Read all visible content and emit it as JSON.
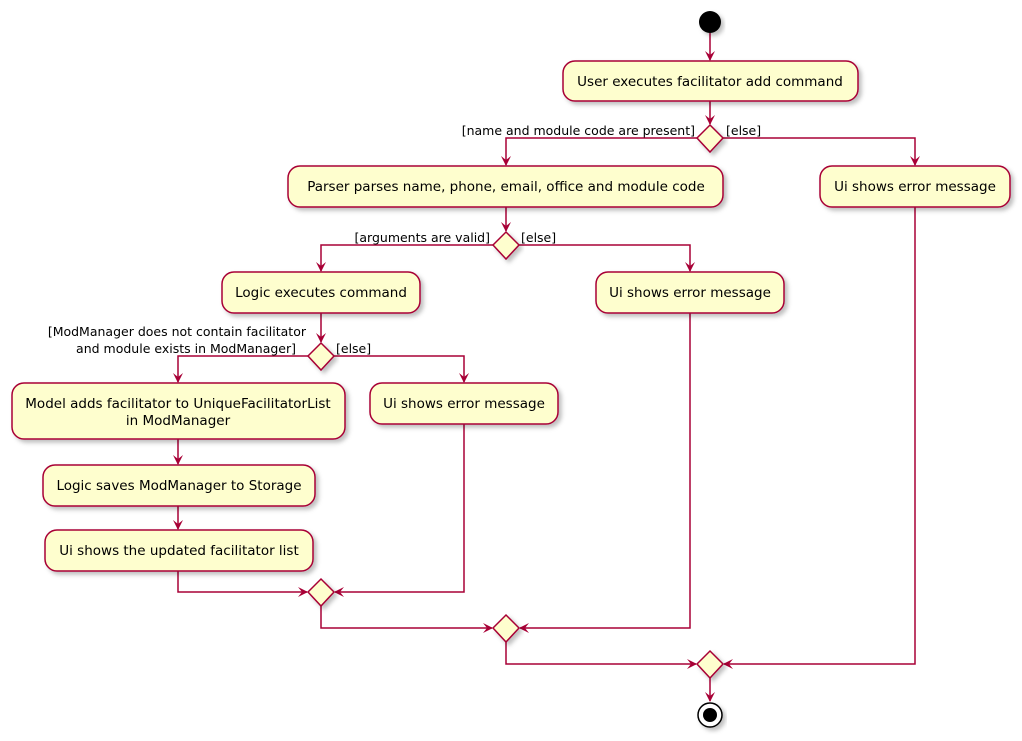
{
  "colors": {
    "fill": "#FEFECE",
    "stroke": "#A80036",
    "node": "#000000"
  },
  "activities": {
    "user_executes": "User executes facilitator add command",
    "parser_parses": "Parser parses name, phone, email, office and module code",
    "error_1": "Ui shows error message",
    "logic_executes": "Logic executes command",
    "error_2": "Ui shows error message",
    "model_adds_line1": "Model adds facilitator to UniqueFacilitatorList",
    "model_adds_line2": "in ModManager",
    "error_3": "Ui shows error message",
    "logic_saves": "Logic saves ModManager to Storage",
    "ui_shows_list": "Ui shows the updated facilitator list"
  },
  "guards": {
    "d1_yes": "[name and module code are present]",
    "d1_else": "[else]",
    "d2_yes": "[arguments are valid]",
    "d2_else": "[else]",
    "d3_yes_line1": "[ModManager does not contain facilitator",
    "d3_yes_line2": "and module exists in ModManager]",
    "d3_else": "[else]"
  }
}
